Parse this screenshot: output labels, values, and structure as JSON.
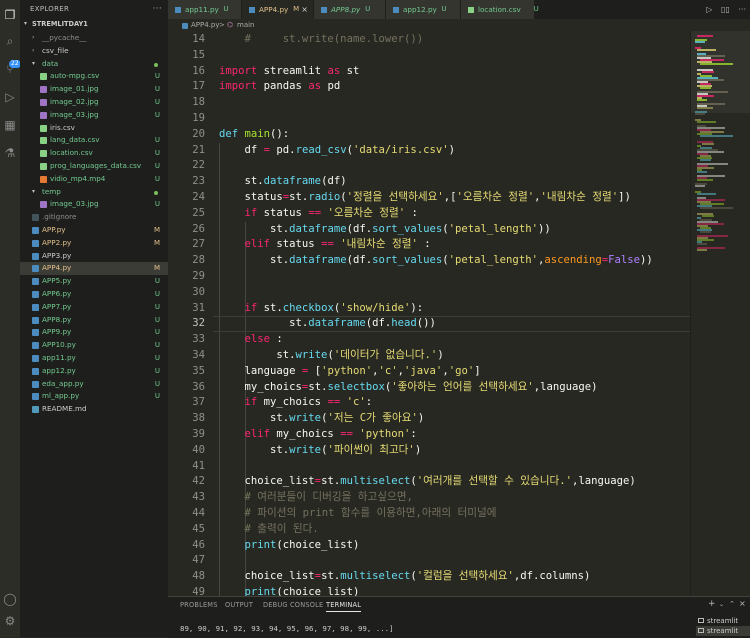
{
  "sidebar": {
    "title": "EXPLORER",
    "folder": "STREMLITDAY1",
    "items": [
      {
        "name": "__pycache__",
        "type": "folder",
        "open": false,
        "depth": 1,
        "status": "",
        "dot": false
      },
      {
        "name": "csv_file",
        "type": "folder",
        "open": false,
        "depth": 1,
        "status": "",
        "dot": false
      },
      {
        "name": "data",
        "type": "folder",
        "open": true,
        "depth": 1,
        "status": "",
        "dot": true
      },
      {
        "name": "auto-mpg.csv",
        "type": "csv",
        "depth": 2,
        "status": "U"
      },
      {
        "name": "image_01.jpg",
        "type": "img",
        "depth": 2,
        "status": "U"
      },
      {
        "name": "image_02.jpg",
        "type": "img",
        "depth": 2,
        "status": "U"
      },
      {
        "name": "image_03.jpg",
        "type": "img",
        "depth": 2,
        "status": "U"
      },
      {
        "name": "iris.csv",
        "type": "csv",
        "depth": 2,
        "status": ""
      },
      {
        "name": "lang_data.csv",
        "type": "csv",
        "depth": 2,
        "status": "U"
      },
      {
        "name": "location.csv",
        "type": "csv",
        "depth": 2,
        "status": "U"
      },
      {
        "name": "prog_languages_data.csv",
        "type": "csv",
        "depth": 2,
        "status": "U"
      },
      {
        "name": "vidio_mp4.mp4",
        "type": "video",
        "depth": 2,
        "status": "U"
      },
      {
        "name": "temp",
        "type": "folder",
        "open": true,
        "depth": 1,
        "status": "",
        "dot": true
      },
      {
        "name": "image_03.jpg",
        "type": "img",
        "depth": 2,
        "status": "U"
      },
      {
        "name": ".gitignore",
        "type": "git",
        "depth": 1,
        "status": ""
      },
      {
        "name": "APP.py",
        "type": "py",
        "depth": 1,
        "status": "M"
      },
      {
        "name": "APP2.py",
        "type": "py",
        "depth": 1,
        "status": "M"
      },
      {
        "name": "APP3.py",
        "type": "py",
        "depth": 1,
        "status": ""
      },
      {
        "name": "APP4.py",
        "type": "py",
        "depth": 1,
        "status": "M",
        "selected": true
      },
      {
        "name": "APP5.py",
        "type": "py",
        "depth": 1,
        "status": "U"
      },
      {
        "name": "APP6.py",
        "type": "py",
        "depth": 1,
        "status": "U"
      },
      {
        "name": "APP7.py",
        "type": "py",
        "depth": 1,
        "status": "U"
      },
      {
        "name": "APP8.py",
        "type": "py",
        "depth": 1,
        "status": "U"
      },
      {
        "name": "APP9.py",
        "type": "py",
        "depth": 1,
        "status": "U"
      },
      {
        "name": "APP10.py",
        "type": "py",
        "depth": 1,
        "status": "U"
      },
      {
        "name": "app11.py",
        "type": "py",
        "depth": 1,
        "status": "U"
      },
      {
        "name": "app12.py",
        "type": "py",
        "depth": 1,
        "status": "U"
      },
      {
        "name": "eda_app.py",
        "type": "py",
        "depth": 1,
        "status": "U"
      },
      {
        "name": "ml_app.py",
        "type": "py",
        "depth": 1,
        "status": "U"
      },
      {
        "name": "README.md",
        "type": "md",
        "depth": 1,
        "status": ""
      }
    ]
  },
  "activity_badge": "22",
  "tabs": [
    {
      "name": "app11.py",
      "status": "U",
      "active": false,
      "italic": false
    },
    {
      "name": "APP4.py",
      "status": "M",
      "active": true,
      "italic": false
    },
    {
      "name": "APP8.py",
      "status": "U",
      "active": false,
      "italic": true
    },
    {
      "name": "app12.py",
      "status": "U",
      "active": false,
      "italic": false
    },
    {
      "name": "location.csv",
      "status": "U",
      "active": false,
      "italic": false
    }
  ],
  "breadcrumb": {
    "file": "APP4.py",
    "sep": ">",
    "symbol": "main"
  },
  "editor": {
    "current_line": 32,
    "lines": [
      {
        "n": 14,
        "t": "    #     st.write(name.lower())"
      },
      {
        "n": 15,
        "t": ""
      },
      {
        "n": 16,
        "t": "import streamlit as st"
      },
      {
        "n": 17,
        "t": "import pandas as pd"
      },
      {
        "n": 18,
        "t": ""
      },
      {
        "n": 19,
        "t": ""
      },
      {
        "n": 20,
        "t": "def main():"
      },
      {
        "n": 21,
        "t": "    df = pd.read_csv('data/iris.csv')"
      },
      {
        "n": 22,
        "t": ""
      },
      {
        "n": 23,
        "t": "    st.dataframe(df)"
      },
      {
        "n": 24,
        "t": "    status=st.radio('정렬을 선택하세요',['오름차순 정렬','내림차순 정렬'])"
      },
      {
        "n": 25,
        "t": "    if status == '오름차순 정렬' :"
      },
      {
        "n": 26,
        "t": "        st.dataframe(df.sort_values('petal_length'))"
      },
      {
        "n": 27,
        "t": "    elif status == '내림차순 정렬' :"
      },
      {
        "n": 28,
        "t": "        st.dataframe(df.sort_values('petal_length',ascending=False))"
      },
      {
        "n": 29,
        "t": ""
      },
      {
        "n": 30,
        "t": ""
      },
      {
        "n": 31,
        "t": "    if st.checkbox('show/hide'):"
      },
      {
        "n": 32,
        "t": "           st.dataframe(df.head())"
      },
      {
        "n": 33,
        "t": "    else :"
      },
      {
        "n": 34,
        "t": "         st.write('데이터가 없습니다.')"
      },
      {
        "n": 35,
        "t": "    language = ['python','c','java','go']"
      },
      {
        "n": 36,
        "t": "    my_choics=st.selectbox('좋아하는 언어를 선택하세요',language)"
      },
      {
        "n": 37,
        "t": "    if my_choics == 'c':"
      },
      {
        "n": 38,
        "t": "        st.write('저는 C가 좋아요')"
      },
      {
        "n": 39,
        "t": "    elif my_choics == 'python':"
      },
      {
        "n": 40,
        "t": "        st.write('파이썬이 최고다')"
      },
      {
        "n": 41,
        "t": ""
      },
      {
        "n": 42,
        "t": "    choice_list=st.multiselect('여러개를 선택할 수 있습니다.',language)"
      },
      {
        "n": 43,
        "t": "    # 여러분들이 디버깅을 하고싶으면,"
      },
      {
        "n": 44,
        "t": "    # 파이션의 print 함수를 이용하면,아래의 터미널에"
      },
      {
        "n": 45,
        "t": "    # 출력이 된다."
      },
      {
        "n": 46,
        "t": "    print(choice_list)"
      },
      {
        "n": 47,
        "t": ""
      },
      {
        "n": 48,
        "t": "    choice_list=st.multiselect('컬럼을 선택하세요',df.columns)"
      },
      {
        "n": 49,
        "t": "    print(choice_list)"
      }
    ]
  },
  "panel": {
    "tabs": [
      "PROBLEMS",
      "OUTPUT",
      "DEBUG CONSOLE",
      "TERMINAL"
    ],
    "active_tab": "TERMINAL",
    "terminal_output": "89, 90, 91, 92, 93, 94, 95, 96, 97, 98, 99, ...]",
    "terminals": [
      "streamlit",
      "streamlit"
    ]
  },
  "colors": {
    "editor_bg": "#272822",
    "keyword": "#f92672",
    "string": "#e6db74",
    "function": "#a6e22e",
    "comment": "#75715e",
    "number": "#ae81ff",
    "status_untracked": "#73c991",
    "status_modified": "#e2c08d"
  }
}
